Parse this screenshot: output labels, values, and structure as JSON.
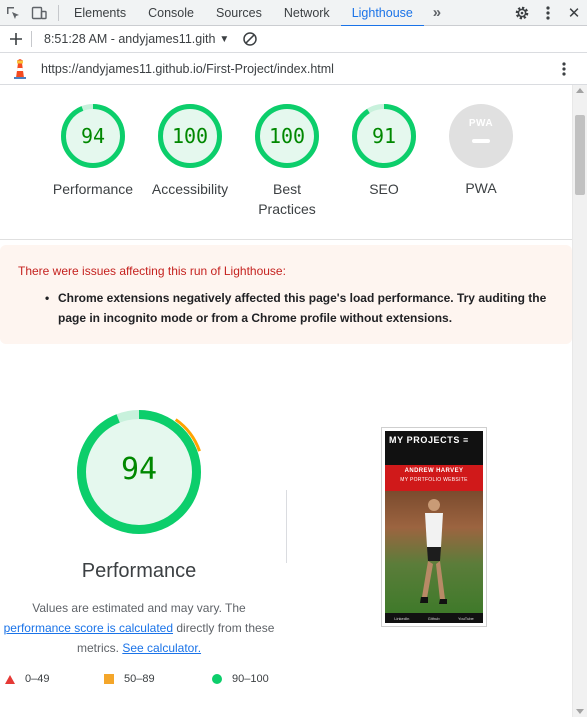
{
  "devtools": {
    "tabs": [
      "Elements",
      "Console",
      "Sources",
      "Network",
      "Lighthouse"
    ],
    "active_tab": "Lighthouse"
  },
  "toolbar": {
    "report_label": "8:51:28 AM - andyjames11.gith"
  },
  "urlbar": {
    "url": "https://andyjames11.github.io/First-Project/index.html"
  },
  "scores": [
    {
      "label": "Performance",
      "score": "94",
      "value": 94
    },
    {
      "label": "Accessibility",
      "score": "100",
      "value": 100
    },
    {
      "label": "Best\nPractices",
      "score": "100",
      "value": 100
    },
    {
      "label": "SEO",
      "score": "91",
      "value": 91
    }
  ],
  "pwa": {
    "label": "PWA",
    "badge": "PWA"
  },
  "warning": {
    "title": "There were issues affecting this run of Lighthouse:",
    "item": "Chrome extensions negatively affected this page's load performance. Try auditing the page in incognito mode or from a Chrome profile without extensions."
  },
  "performance": {
    "score": "94",
    "title": "Performance",
    "desc_part1": "Values are estimated and may vary. The ",
    "link1": "performance score is calculated",
    "desc_part2": " directly from these metrics. ",
    "link2": "See calculator."
  },
  "legend": {
    "fail": "0–49",
    "average": "50–89",
    "pass": "90–100"
  },
  "thumbnail": {
    "heading": "MY PROJECTS ≡",
    "name": "ANDREW HARVEY",
    "subtitle": "MY PORTFOLIO WEBSITE",
    "footer": [
      "LinkedIn",
      "Github",
      "YouTube"
    ]
  },
  "colors": {
    "pass": "#0cce6b",
    "average": "#ffa400",
    "fail": "#ff4e42",
    "accent": "#1a73e8"
  }
}
